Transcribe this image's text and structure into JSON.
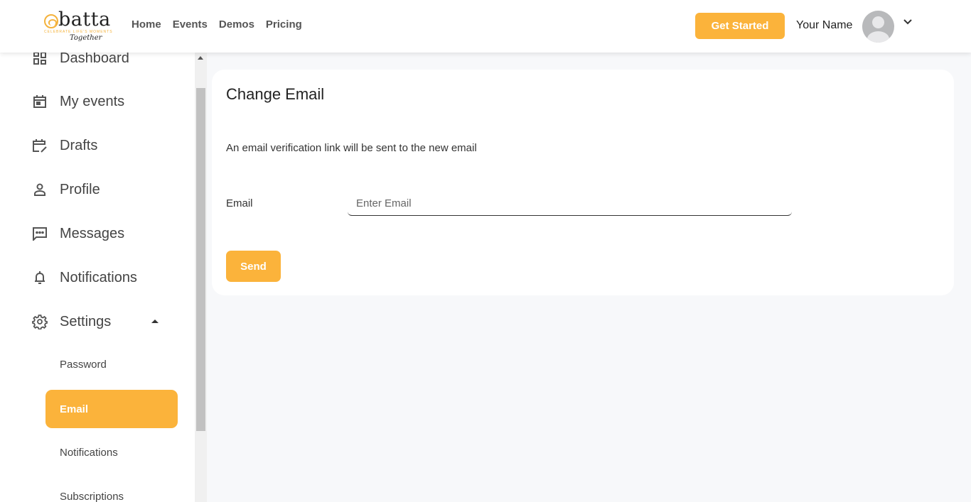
{
  "header": {
    "logo": {
      "name": "batta",
      "tagline": "CELEBRATE LIFE'S MOMENTS",
      "script": "Together"
    },
    "nav": [
      {
        "label": "Home"
      },
      {
        "label": "Events"
      },
      {
        "label": "Demos"
      },
      {
        "label": "Pricing"
      }
    ],
    "cta_label": "Get Started",
    "user_name": "Your Name",
    "avatar_icon": "user-avatar-icon",
    "menu_icon": "chevron-down-icon"
  },
  "sidebar": {
    "items": [
      {
        "label": "Dashboard",
        "icon": "dashboard-icon"
      },
      {
        "label": "My events",
        "icon": "calendar-icon"
      },
      {
        "label": "Drafts",
        "icon": "calendar-edit-icon"
      },
      {
        "label": "Profile",
        "icon": "person-icon"
      },
      {
        "label": "Messages",
        "icon": "message-icon"
      },
      {
        "label": "Notifications",
        "icon": "bell-icon"
      },
      {
        "label": "Settings",
        "icon": "gear-icon",
        "expanded": true
      }
    ],
    "settings_sub": [
      {
        "label": "Password",
        "active": false
      },
      {
        "label": "Email",
        "active": true
      },
      {
        "label": "Notifications",
        "active": false
      },
      {
        "label": "Subscriptions",
        "active": false
      }
    ]
  },
  "main": {
    "title": "Change Email",
    "description": "An email verification link will be sent to the new email",
    "email_label": "Email",
    "email_value": "",
    "email_placeholder": "Enter Email",
    "send_label": "Send"
  },
  "colors": {
    "accent": "#fbb33b",
    "background": "#f7f8fa",
    "card": "#ffffff"
  }
}
